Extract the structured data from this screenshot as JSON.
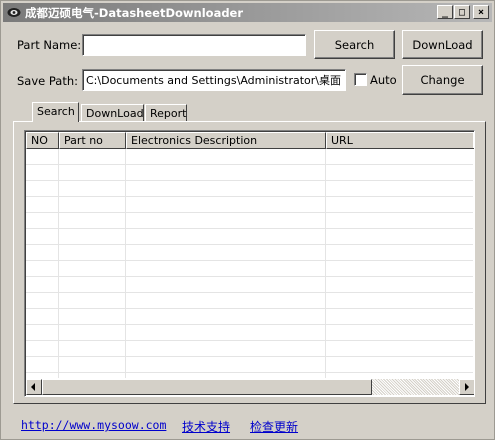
{
  "window": {
    "title": "成都迈硕电气-DatasheetDownloader",
    "controls": {
      "minimize": "_",
      "maximize": "□",
      "close": "×"
    }
  },
  "form": {
    "part_name_label": "Part Name:",
    "part_name_value": "",
    "save_path_label": "Save Path:",
    "save_path_value": "C:\\Documents and Settings\\Administrator\\桌面",
    "auto_label": "Auto",
    "auto_checked": false
  },
  "buttons": {
    "search": "Search",
    "download": "DownLoad",
    "change": "Change"
  },
  "tabs": [
    {
      "label": "Search",
      "active": true
    },
    {
      "label": "DownLoad",
      "active": false
    },
    {
      "label": "Report",
      "active": false
    }
  ],
  "table": {
    "columns": [
      "NO",
      "Part no",
      "Electronics Description",
      "URL"
    ],
    "rows": []
  },
  "footer": {
    "website_link": "http://www.mysoow.com",
    "support_link": "技术支持",
    "update_link": "检查更新"
  },
  "icons": {
    "app": "app-logo-icon",
    "scroll_left": "arrow-left-icon",
    "scroll_right": "arrow-right-icon"
  }
}
